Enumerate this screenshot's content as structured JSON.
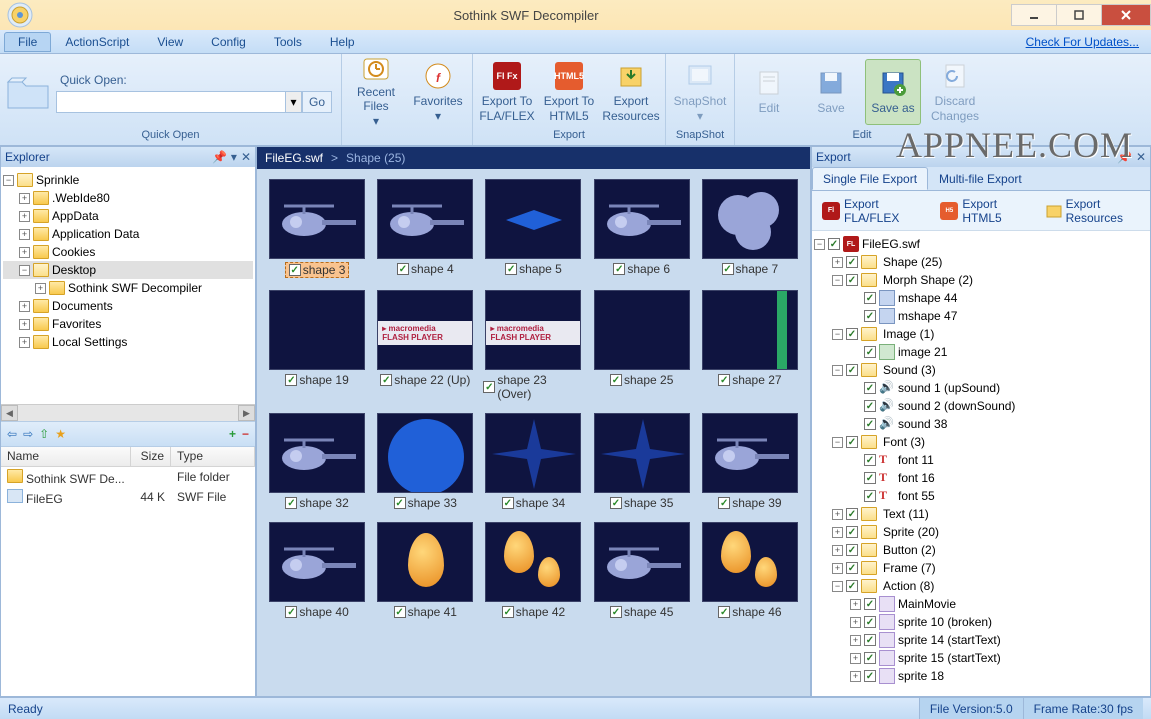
{
  "app_title": "Sothink SWF Decompiler",
  "watermark": "APPNEE.COM",
  "menus": [
    "File",
    "ActionScript",
    "View",
    "Config",
    "Tools",
    "Help"
  ],
  "menu_right": "Check For Updates...",
  "ribbon": {
    "quickopen_label": "Quick Open:",
    "go": "Go",
    "groups": {
      "quickopen": "Quick Open",
      "export": "Export",
      "snapshot": "SnapShot",
      "edit": "Edit"
    },
    "buttons": {
      "recent": "Recent Files",
      "favorites": "Favorites",
      "export_fla": "Export To FLA/FLEX",
      "export_html5": "Export To HTML5",
      "export_res": "Export Resources",
      "snapshot": "SnapShot",
      "edit": "Edit",
      "save": "Save",
      "saveas": "Save as",
      "discard": "Discard Changes"
    }
  },
  "explorer": {
    "title": "Explorer",
    "root": "Sprinkle",
    "items": [
      ".WebIde80",
      "AppData",
      "Application Data",
      "Cookies",
      "Desktop",
      "Documents",
      "Favorites",
      "Local Settings"
    ],
    "desktop_child": "Sothink SWF Decompiler"
  },
  "filelist": {
    "cols": [
      "Name",
      "Size",
      "Type"
    ],
    "rows": [
      {
        "name": "Sothink SWF De...",
        "size": "",
        "type": "File folder"
      },
      {
        "name": "FileEG",
        "size": "44 K",
        "type": "SWF File"
      }
    ]
  },
  "breadcrumb": {
    "file": "FileEG.swf",
    "sep": ">",
    "cat": "Shape (25)"
  },
  "thumbs": [
    {
      "label": "shape 3",
      "sel": true,
      "kind": "heli"
    },
    {
      "label": "shape 4",
      "kind": "heli"
    },
    {
      "label": "shape 5",
      "kind": "bowtie"
    },
    {
      "label": "shape 6",
      "kind": "heli"
    },
    {
      "label": "shape 7",
      "kind": "cloud"
    },
    {
      "label": "shape 19",
      "kind": "blank"
    },
    {
      "label": "shape 22 (Up)",
      "kind": "mm"
    },
    {
      "label": "shape 23 (Over)",
      "kind": "mm"
    },
    {
      "label": "shape 25",
      "kind": "blank"
    },
    {
      "label": "shape 27",
      "kind": "green"
    },
    {
      "label": "shape 32",
      "kind": "heli"
    },
    {
      "label": "shape 33",
      "kind": "circle"
    },
    {
      "label": "shape 34",
      "kind": "star"
    },
    {
      "label": "shape 35",
      "kind": "star"
    },
    {
      "label": "shape 39",
      "kind": "heli"
    },
    {
      "label": "shape 40",
      "kind": "heli"
    },
    {
      "label": "shape 41",
      "kind": "drop1"
    },
    {
      "label": "shape 42",
      "kind": "drop2"
    },
    {
      "label": "shape 45",
      "kind": "heli"
    },
    {
      "label": "shape 46",
      "kind": "drop2"
    }
  ],
  "export": {
    "title": "Export",
    "tabs": [
      "Single File Export",
      "Multi-file Export"
    ],
    "actions": {
      "fla": "Export FLA/FLEX",
      "html5": "Export HTML5",
      "res": "Export Resources"
    },
    "tree": [
      {
        "d": 0,
        "exp": "-",
        "ico": "fl",
        "label": "FileEG.swf"
      },
      {
        "d": 1,
        "exp": "+",
        "ico": "fld",
        "label": "Shape (25)"
      },
      {
        "d": 1,
        "exp": "-",
        "ico": "fld",
        "label": "Morph Shape (2)"
      },
      {
        "d": 2,
        "ico": "ms",
        "label": "mshape 44"
      },
      {
        "d": 2,
        "ico": "ms",
        "label": "mshape 47"
      },
      {
        "d": 1,
        "exp": "-",
        "ico": "fld",
        "label": "Image (1)"
      },
      {
        "d": 2,
        "ico": "img",
        "label": "image 21"
      },
      {
        "d": 1,
        "exp": "-",
        "ico": "fld",
        "label": "Sound (3)"
      },
      {
        "d": 2,
        "ico": "snd",
        "label": "sound 1 (upSound)"
      },
      {
        "d": 2,
        "ico": "snd",
        "label": "sound 2 (downSound)"
      },
      {
        "d": 2,
        "ico": "snd",
        "label": "sound 38"
      },
      {
        "d": 1,
        "exp": "-",
        "ico": "fld",
        "label": "Font (3)"
      },
      {
        "d": 2,
        "ico": "fnt",
        "label": "font 11"
      },
      {
        "d": 2,
        "ico": "fnt",
        "label": "font 16"
      },
      {
        "d": 2,
        "ico": "fnt",
        "label": "font 55"
      },
      {
        "d": 1,
        "exp": "+",
        "ico": "fld",
        "label": "Text (11)"
      },
      {
        "d": 1,
        "exp": "+",
        "ico": "fld",
        "label": "Sprite (20)"
      },
      {
        "d": 1,
        "exp": "+",
        "ico": "fld",
        "label": "Button (2)"
      },
      {
        "d": 1,
        "exp": "+",
        "ico": "fld",
        "label": "Frame (7)"
      },
      {
        "d": 1,
        "exp": "-",
        "ico": "fld",
        "label": "Action (8)"
      },
      {
        "d": 2,
        "exp": "+",
        "ico": "act",
        "label": "MainMovie"
      },
      {
        "d": 2,
        "exp": "+",
        "ico": "act",
        "label": "sprite 10 (broken)"
      },
      {
        "d": 2,
        "exp": "+",
        "ico": "act",
        "label": "sprite 14 (startText)"
      },
      {
        "d": 2,
        "exp": "+",
        "ico": "act",
        "label": "sprite 15 (startText)"
      },
      {
        "d": 2,
        "exp": "+",
        "ico": "act",
        "label": "sprite 18"
      }
    ]
  },
  "status": {
    "ready": "Ready",
    "ver": "File Version:5.0",
    "fps": "Frame Rate:30 fps"
  }
}
